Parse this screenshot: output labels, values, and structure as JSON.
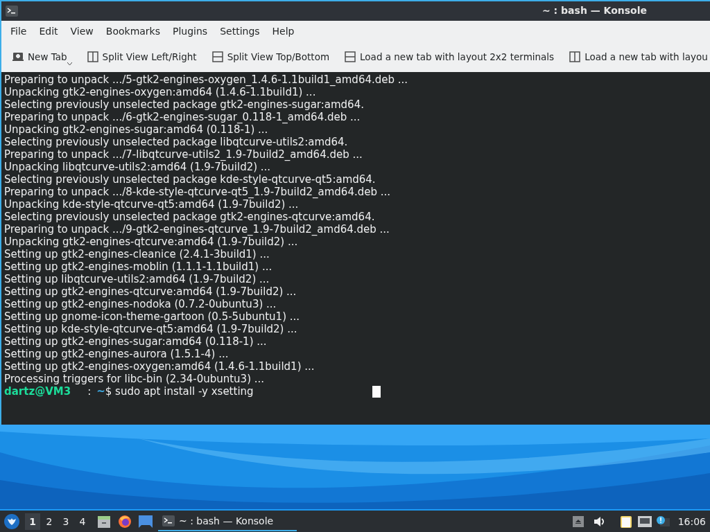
{
  "window": {
    "title": "~ : bash — Konsole"
  },
  "menu": [
    "File",
    "Edit",
    "View",
    "Bookmarks",
    "Plugins",
    "Settings",
    "Help"
  ],
  "toolbar": [
    {
      "label": "New Tab",
      "kind": "new-tab",
      "dropdown": true
    },
    {
      "label": "Split View Left/Right",
      "kind": "split-lr",
      "dropdown": false
    },
    {
      "label": "Split View Top/Bottom",
      "kind": "split-tb",
      "dropdown": false
    },
    {
      "label": "Load a new tab with layout 2x2 terminals",
      "kind": "split-tb",
      "dropdown": false
    },
    {
      "label": "Load a new tab with layou",
      "kind": "split-lr",
      "dropdown": false
    }
  ],
  "terminal": {
    "lines": [
      "Preparing to unpack .../5-gtk2-engines-oxygen_1.4.6-1.1build1_amd64.deb ...",
      "Unpacking gtk2-engines-oxygen:amd64 (1.4.6-1.1build1) ...",
      "Selecting previously unselected package gtk2-engines-sugar:amd64.",
      "Preparing to unpack .../6-gtk2-engines-sugar_0.118-1_amd64.deb ...",
      "Unpacking gtk2-engines-sugar:amd64 (0.118-1) ...",
      "Selecting previously unselected package libqtcurve-utils2:amd64.",
      "Preparing to unpack .../7-libqtcurve-utils2_1.9-7build2_amd64.deb ...",
      "Unpacking libqtcurve-utils2:amd64 (1.9-7build2) ...",
      "Selecting previously unselected package kde-style-qtcurve-qt5:amd64.",
      "Preparing to unpack .../8-kde-style-qtcurve-qt5_1.9-7build2_amd64.deb ...",
      "Unpacking kde-style-qtcurve-qt5:amd64 (1.9-7build2) ...",
      "Selecting previously unselected package gtk2-engines-qtcurve:amd64.",
      "Preparing to unpack .../9-gtk2-engines-qtcurve_1.9-7build2_amd64.deb ...",
      "Unpacking gtk2-engines-qtcurve:amd64 (1.9-7build2) ...",
      "Setting up gtk2-engines-cleanice (2.4.1-3build1) ...",
      "Setting up gtk2-engines-moblin (1.1.1-1.1build1) ...",
      "Setting up libqtcurve-utils2:amd64 (1.9-7build2) ...",
      "Setting up gtk2-engines-qtcurve:amd64 (1.9-7build2) ...",
      "Setting up gtk2-engines-nodoka (0.7.2-0ubuntu3) ...",
      "Setting up gnome-icon-theme-gartoon (0.5-5ubuntu1) ...",
      "Setting up kde-style-qtcurve-qt5:amd64 (1.9-7build2) ...",
      "Setting up gtk2-engines-sugar:amd64 (0.118-1) ...",
      "Setting up gtk2-engines-aurora (1.5.1-4) ...",
      "Setting up gtk2-engines-oxygen:amd64 (1.4.6-1.1build1) ...",
      "Processing triggers for libc-bin (2.34-0ubuntu3) ..."
    ],
    "prompt": {
      "user": "dartz@VM3",
      "separator": ":",
      "path": "~",
      "command": "$ sudo apt install -y xsetting"
    }
  },
  "taskbar": {
    "desktops": [
      {
        "label": "1",
        "selected": true
      },
      {
        "label": "2",
        "selected": false
      },
      {
        "label": "3",
        "selected": false
      },
      {
        "label": "4",
        "selected": false
      }
    ],
    "tasks": [
      {
        "title": "~ : bash — Konsole",
        "selected": true
      }
    ],
    "clock": "16:06"
  }
}
